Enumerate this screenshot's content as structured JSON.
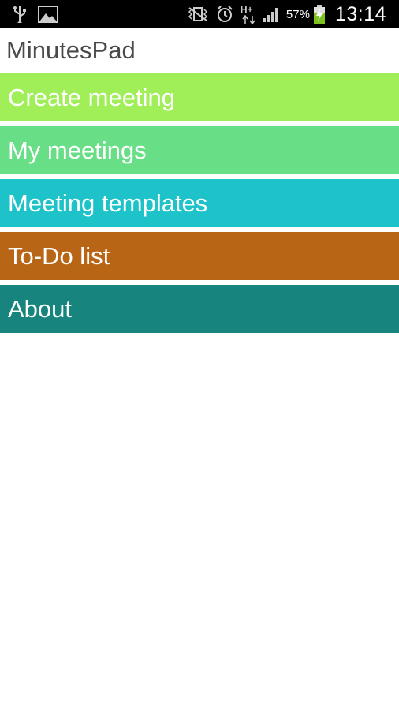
{
  "status_bar": {
    "icons_left": [
      "usb-icon",
      "image-icon"
    ],
    "icons_right": [
      "vibrate-icon",
      "alarm-icon",
      "network-hplus-icon",
      "signal-icon",
      "battery-charging-icon"
    ],
    "network_label": "H+",
    "battery_percent": "57%",
    "time": "13:14"
  },
  "app": {
    "title": "MinutesPad"
  },
  "menu": {
    "items": [
      {
        "label": "Create meeting",
        "color": "#a0ee58"
      },
      {
        "label": "My meetings",
        "color": "#68de86"
      },
      {
        "label": "Meeting templates",
        "color": "#1dc3c9"
      },
      {
        "label": "To-Do list",
        "color": "#b96516"
      },
      {
        "label": "About",
        "color": "#17857e"
      }
    ]
  }
}
